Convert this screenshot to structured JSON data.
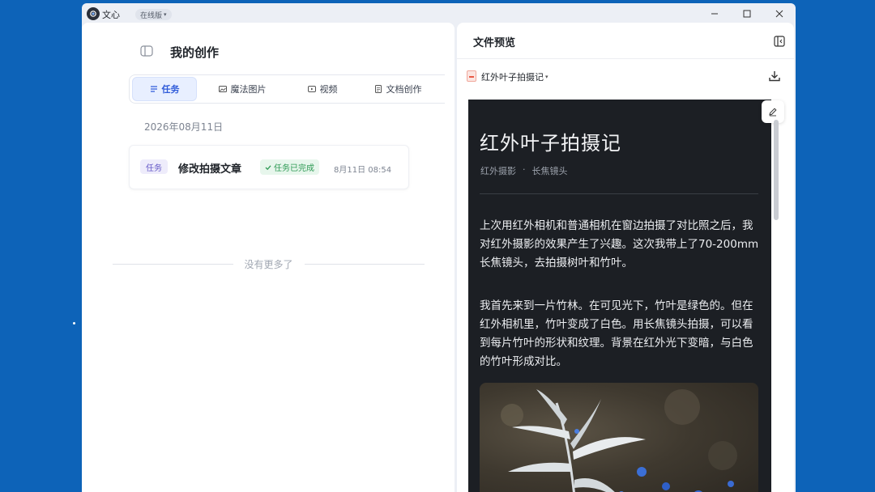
{
  "app": {
    "name": "文心",
    "version_label": "在线版"
  },
  "left": {
    "title": "我的创作",
    "tabs": [
      {
        "label": "任务",
        "icon": "list-icon",
        "active": true
      },
      {
        "label": "魔法图片",
        "icon": "image-icon",
        "active": false
      },
      {
        "label": "视频",
        "icon": "play-icon",
        "active": false
      },
      {
        "label": "文档创作",
        "icon": "document-icon",
        "active": false
      }
    ],
    "date_label": "2026年08月11日",
    "task": {
      "tag": "任务",
      "title": "修改拍摄文章",
      "status": "任务已完成",
      "time": "8月11日 08:54"
    },
    "no_more_text": "没有更多了"
  },
  "right": {
    "title": "文件预览",
    "file_name": "红外叶子拍摄记",
    "article": {
      "title": "红外叶子拍摄记",
      "tags": [
        "红外摄影",
        "长焦镜头"
      ],
      "tag_separator": "·",
      "paragraphs": [
        "上次用红外相机和普通相机在窗边拍摄了对比照之后，我对红外摄影的效果产生了兴趣。这次我带上了70-200mm长焦镜头，去拍摄树叶和竹叶。",
        "我首先来到一片竹林。在可见光下，竹叶是绿色的。但在红外相机里，竹叶变成了白色。用长焦镜头拍摄，可以看到每片竹叶的形状和纹理。背景在红外光下变暗，与白色的竹叶形成对比。"
      ]
    }
  },
  "colors": {
    "desktop": "#0d63b8",
    "accent": "#2f5bd9",
    "success": "#2e9a54",
    "preview_bg": "#1c1f24"
  }
}
